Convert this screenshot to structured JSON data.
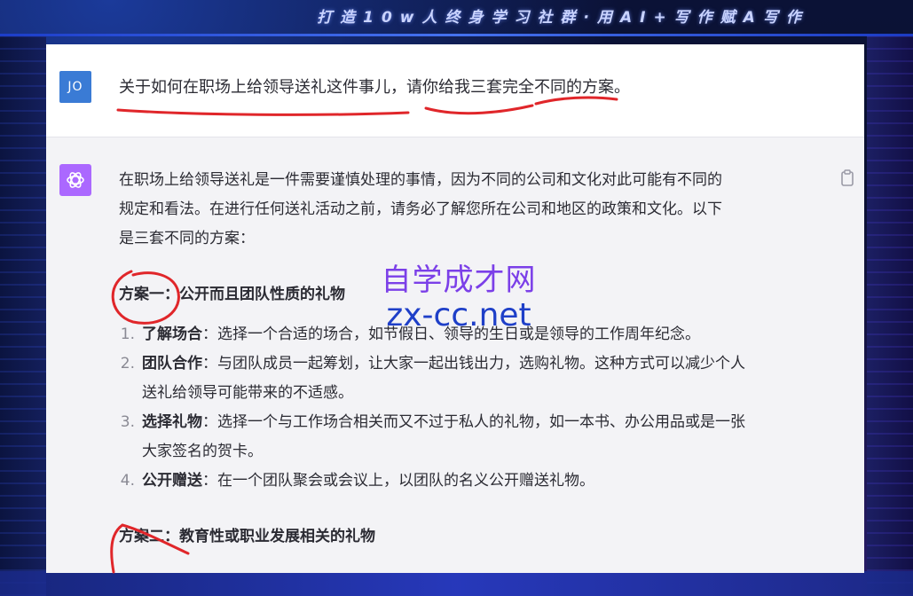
{
  "banner": {
    "text": "打造10w人终身学习社群·用AI+写作赋A写作"
  },
  "user": {
    "avatar_initials": "JO",
    "message": "关于如何在职场上给领导送礼这件事儿，请你给我三套完全不同的方案。"
  },
  "assistant": {
    "avatar_icon": "openai-logo-icon",
    "copy_icon": "clipboard-icon",
    "intro_lines": [
      "在职场上给领导送礼是一件需要谨慎处理的事情，因为不同的公司和文化对此可能有不同的",
      "规定和看法。在进行任何送礼活动之前，请务必了解您所在公司和地区的政策和文化。以下",
      "是三套不同的方案："
    ],
    "plan1": {
      "heading": "方案一：公开而且团队性质的礼物",
      "items": [
        {
          "num": "1.",
          "term": "了解场合",
          "lines": [
            "：选择一个合适的场合，如节假日、领导的生日或是领导的工作周年纪念。"
          ]
        },
        {
          "num": "2.",
          "term": "团队合作",
          "lines": [
            "：与团队成员一起筹划，让大家一起出钱出力，选购礼物。这种方式可以减少个人",
            "送礼给领导可能带来的不适感。"
          ]
        },
        {
          "num": "3.",
          "term": "选择礼物",
          "lines": [
            "：选择一个与工作场合相关而又不过于私人的礼物，如一本书、办公用品或是一张",
            "大家签名的贺卡。"
          ]
        },
        {
          "num": "4.",
          "term": "公开赠送",
          "lines": [
            "：在一个团队聚会或会议上，以团队的名义公开赠送礼物。"
          ]
        }
      ]
    },
    "plan2": {
      "heading": "方案二：教育性或职业发展相关的礼物"
    }
  },
  "watermark": {
    "name": "自学成才网",
    "url": "zx-cc.net"
  },
  "colors": {
    "user_avatar": "#3a7bd5",
    "assistant_avatar": "#ab68ff",
    "annotation": "#e0262a",
    "watermark_name": "#7b3fe8",
    "watermark_url": "#1e3fc8"
  }
}
